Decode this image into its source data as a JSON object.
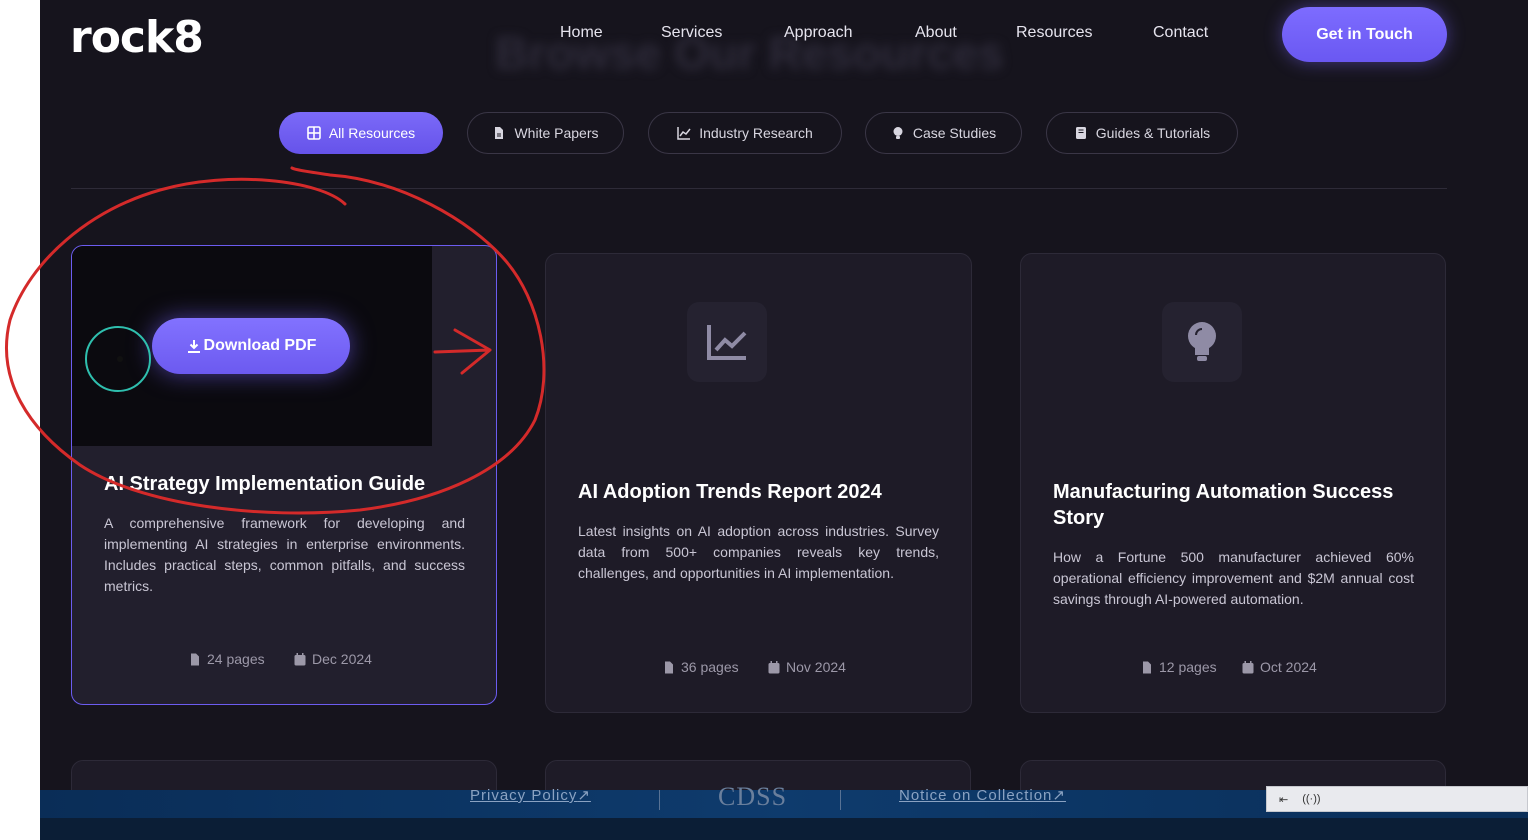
{
  "header": {
    "logo": "rock8",
    "ghost_heading": "Browse Our Resources",
    "nav": [
      "Home",
      "Services",
      "Approach",
      "About",
      "Resources",
      "Contact"
    ],
    "cta": "Get in Touch"
  },
  "filters": [
    {
      "label": "All Resources",
      "icon": "grid-icon",
      "active": true
    },
    {
      "label": "White Papers",
      "icon": "file-icon",
      "active": false
    },
    {
      "label": "Industry Research",
      "icon": "chart-line-icon",
      "active": false
    },
    {
      "label": "Case Studies",
      "icon": "lightbulb-icon",
      "active": false
    },
    {
      "label": "Guides & Tutorials",
      "icon": "book-icon",
      "active": false
    }
  ],
  "cards": [
    {
      "title": "AI Strategy Implementation Guide",
      "description": "A comprehensive framework for developing and implementing AI strategies in enterprise environments. Includes practical steps, common pitfalls, and success metrics.",
      "pages": "24 pages",
      "date": "Dec 2024",
      "download_label": "Download PDF",
      "icon": "file-icon"
    },
    {
      "title": "AI Adoption Trends Report 2024",
      "description": "Latest insights on AI adoption across industries. Survey data from 500+ companies reveals key trends, challenges, and opportunities in AI implementation.",
      "pages": "36 pages",
      "date": "Nov 2024",
      "icon": "chart-line-icon"
    },
    {
      "title": "Manufacturing Automation Success Story",
      "description": "How a Fortune 500 manufacturer achieved 60% operational efficiency improvement and $2M annual cost savings through AI-powered automation.",
      "pages": "12 pages",
      "date": "Oct 2024",
      "icon": "lightbulb-icon"
    }
  ],
  "footer": {
    "privacy": "Privacy Policy",
    "logo": "CDSS",
    "notice": "Notice on Collection"
  },
  "colors": {
    "accent": "#6c5cf0",
    "background": "#16141d",
    "card": "#1e1b27",
    "annotation": "#d42a2a"
  }
}
